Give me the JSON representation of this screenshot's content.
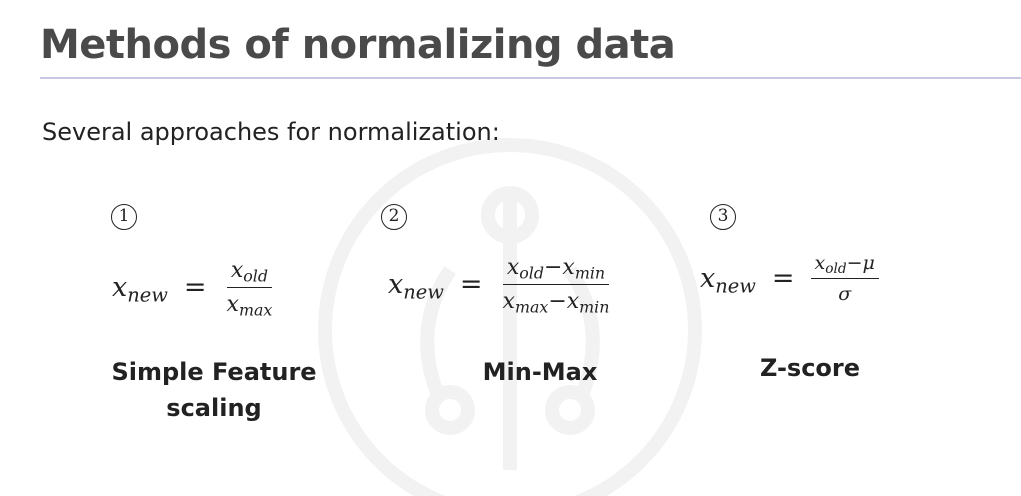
{
  "slide": {
    "title": "Methods of normalizing data",
    "subtitle": "Several approaches for normalization:"
  },
  "methods": [
    {
      "number": "1",
      "lhs_var": "x",
      "lhs_sub": "new",
      "equals": "=",
      "num_var": "x",
      "num_sub": "old",
      "num_rest": "",
      "den_var": "x",
      "den_sub": "max",
      "den_rest": "",
      "label_line1": "Simple Feature",
      "label_line2": "scaling"
    },
    {
      "number": "2",
      "lhs_var": "x",
      "lhs_sub": "new",
      "equals": "=",
      "num_var": "x",
      "num_sub": "old",
      "num_rest": "−x",
      "num_rest_sub": "min",
      "den_var": "x",
      "den_sub": "max",
      "den_rest": "−x",
      "den_rest_sub": "min",
      "label_line1": "Min-Max",
      "label_line2": ""
    },
    {
      "number": "3",
      "lhs_var": "x",
      "lhs_sub": "new",
      "equals": "=",
      "num_var": "x",
      "num_sub": "old",
      "num_rest": "−μ",
      "den_var": "σ",
      "label_line1": "Z-score",
      "label_line2": ""
    }
  ]
}
